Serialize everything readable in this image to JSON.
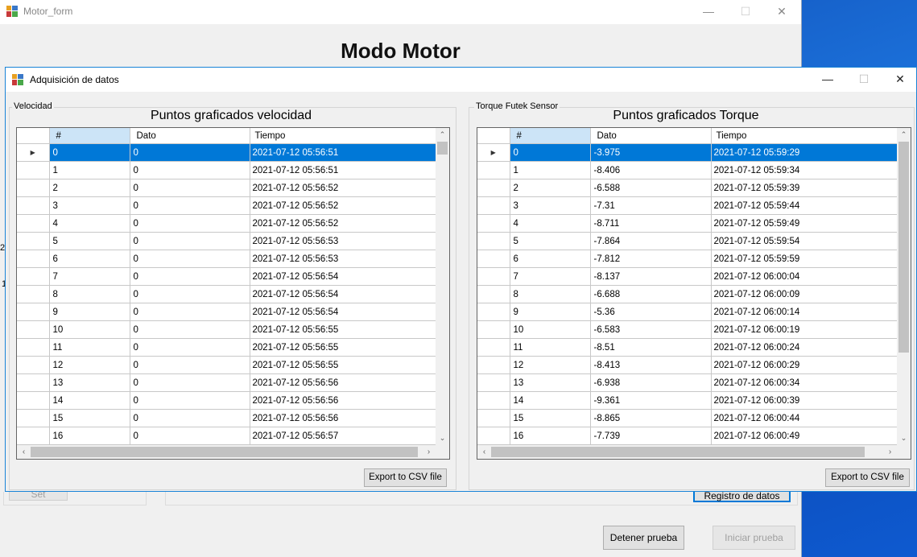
{
  "colors": {
    "accent": "#0078d7",
    "selection": "#0078d7",
    "sort_header": "#cce4f7"
  },
  "back_window": {
    "title": "Motor_form",
    "heading": "Modo Motor",
    "set_button": "Set",
    "registro_button": "Registro de datos",
    "detener_button": "Detener prueba",
    "iniciar_button": "Iniciar prueba",
    "side_digit_1": "2",
    "side_digit_2": "1"
  },
  "window": {
    "title": "Adquisición de datos",
    "minimize_icon": "minimize-icon",
    "maximize_icon": "maximize-icon",
    "close_icon": "close-icon"
  },
  "left_panel": {
    "group_label": "Velocidad",
    "title": "Puntos graficados velocidad",
    "export_button": "Export to CSV file",
    "columns": [
      "#",
      "Dato",
      "Tiempo"
    ],
    "rows": [
      [
        "0",
        "0",
        "2021-07-12 05:56:51"
      ],
      [
        "1",
        "0",
        "2021-07-12 05:56:51"
      ],
      [
        "2",
        "0",
        "2021-07-12 05:56:52"
      ],
      [
        "3",
        "0",
        "2021-07-12 05:56:52"
      ],
      [
        "4",
        "0",
        "2021-07-12 05:56:52"
      ],
      [
        "5",
        "0",
        "2021-07-12 05:56:53"
      ],
      [
        "6",
        "0",
        "2021-07-12 05:56:53"
      ],
      [
        "7",
        "0",
        "2021-07-12 05:56:54"
      ],
      [
        "8",
        "0",
        "2021-07-12 05:56:54"
      ],
      [
        "9",
        "0",
        "2021-07-12 05:56:54"
      ],
      [
        "10",
        "0",
        "2021-07-12 05:56:55"
      ],
      [
        "11",
        "0",
        "2021-07-12 05:56:55"
      ],
      [
        "12",
        "0",
        "2021-07-12 05:56:55"
      ],
      [
        "13",
        "0",
        "2021-07-12 05:56:56"
      ],
      [
        "14",
        "0",
        "2021-07-12 05:56:56"
      ],
      [
        "15",
        "0",
        "2021-07-12 05:56:56"
      ],
      [
        "16",
        "0",
        "2021-07-12 05:56:57"
      ]
    ]
  },
  "right_panel": {
    "group_label": "Torque Futek Sensor",
    "title": "Puntos graficados Torque",
    "export_button": "Export to CSV file",
    "columns": [
      "#",
      "Dato",
      "Tiempo"
    ],
    "rows": [
      [
        "0",
        "-3.975",
        "2021-07-12 05:59:29"
      ],
      [
        "1",
        "-8.406",
        "2021-07-12 05:59:34"
      ],
      [
        "2",
        "-6.588",
        "2021-07-12 05:59:39"
      ],
      [
        "3",
        "-7.31",
        "2021-07-12 05:59:44"
      ],
      [
        "4",
        "-8.711",
        "2021-07-12 05:59:49"
      ],
      [
        "5",
        "-7.864",
        "2021-07-12 05:59:54"
      ],
      [
        "6",
        "-7.812",
        "2021-07-12 05:59:59"
      ],
      [
        "7",
        "-8.137",
        "2021-07-12 06:00:04"
      ],
      [
        "8",
        "-6.688",
        "2021-07-12 06:00:09"
      ],
      [
        "9",
        "-5.36",
        "2021-07-12 06:00:14"
      ],
      [
        "10",
        "-6.583",
        "2021-07-12 06:00:19"
      ],
      [
        "11",
        "-8.51",
        "2021-07-12 06:00:24"
      ],
      [
        "12",
        "-8.413",
        "2021-07-12 06:00:29"
      ],
      [
        "13",
        "-6.938",
        "2021-07-12 06:00:34"
      ],
      [
        "14",
        "-9.361",
        "2021-07-12 06:00:39"
      ],
      [
        "15",
        "-8.865",
        "2021-07-12 06:00:44"
      ],
      [
        "16",
        "-7.739",
        "2021-07-12 06:00:49"
      ]
    ]
  }
}
